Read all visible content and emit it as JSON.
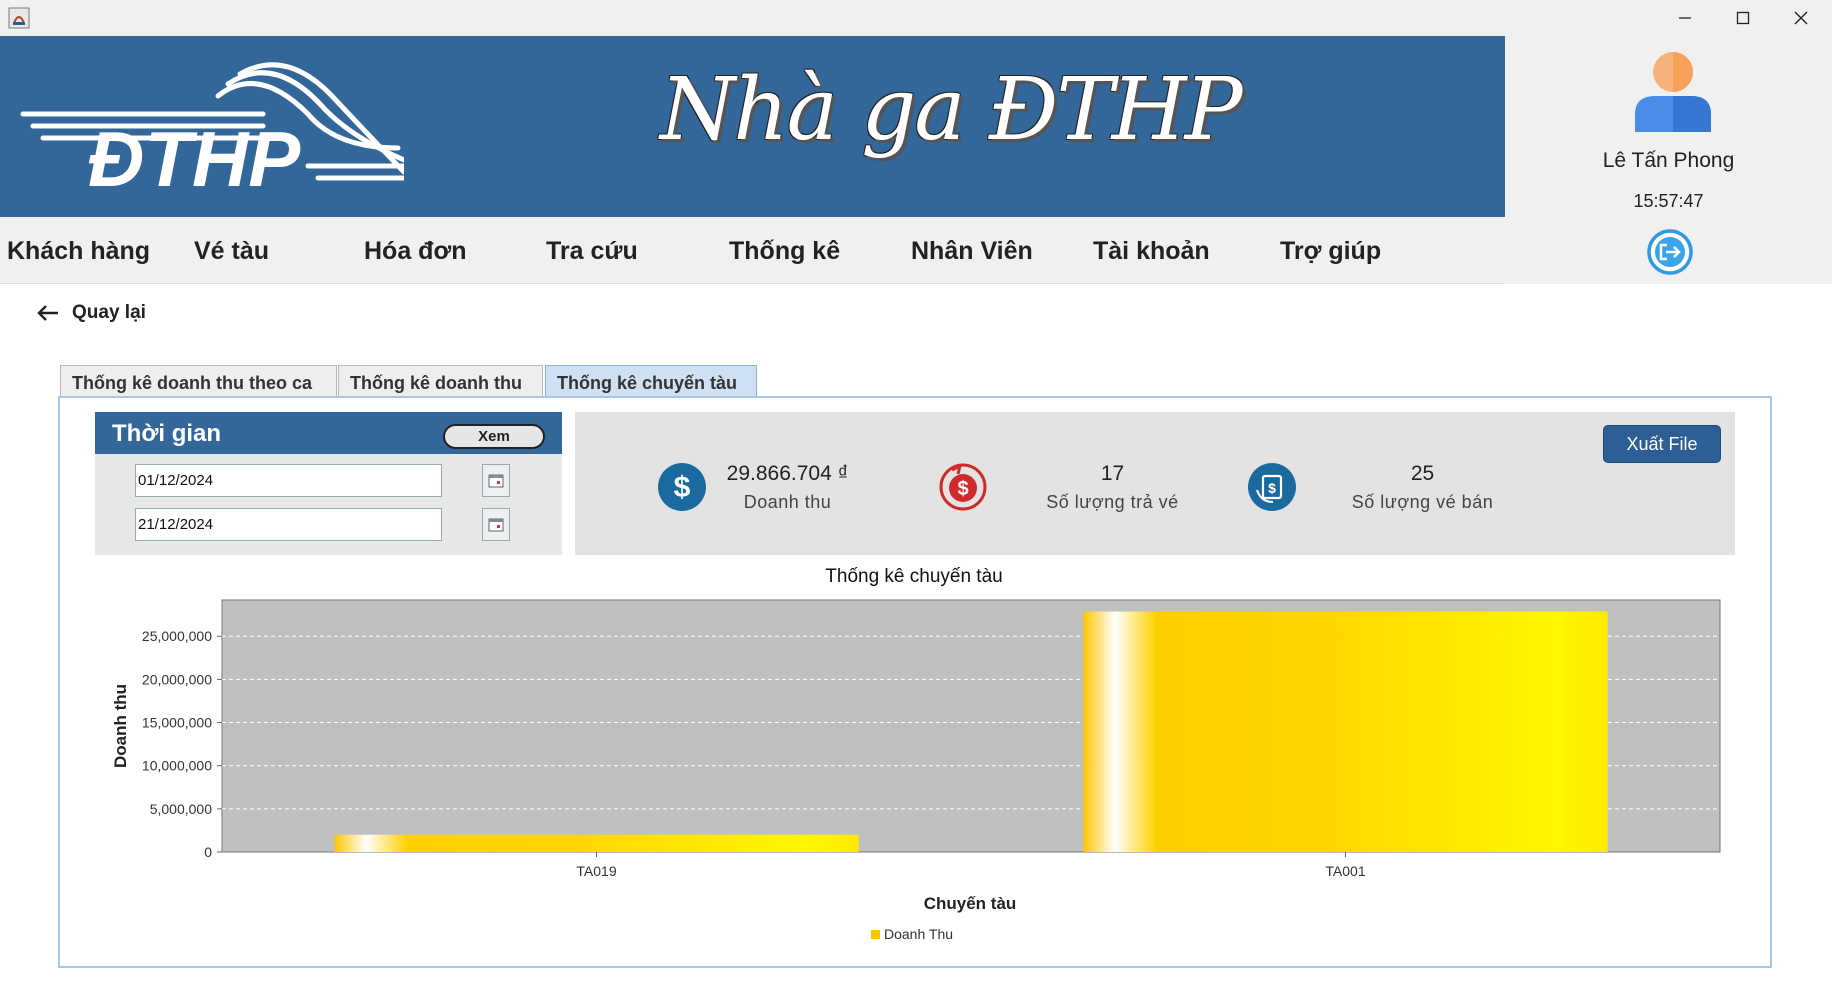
{
  "window": {
    "controls": [
      "minimize",
      "maximize",
      "close"
    ]
  },
  "header": {
    "logo_text": "ĐTHP",
    "title": "Nhà ga ĐTHP"
  },
  "user": {
    "name": "Lê Tấn Phong",
    "clock": "15:57:47"
  },
  "menu": [
    {
      "label": "Khách hàng"
    },
    {
      "label": "Vé tàu"
    },
    {
      "label": "Hóa đơn"
    },
    {
      "label": "Tra cứu"
    },
    {
      "label": "Thống kê"
    },
    {
      "label": "Nhân Viên"
    },
    {
      "label": "Tài khoản"
    },
    {
      "label": "Trợ giúp"
    }
  ],
  "back": {
    "label": "Quay lại"
  },
  "tabs": [
    {
      "label": "Thống kê doanh thu theo ca",
      "active": false
    },
    {
      "label": "Thống kê doanh thu",
      "active": false
    },
    {
      "label": "Thống kê chuyến tàu",
      "active": true
    }
  ],
  "time_panel": {
    "title": "Thời gian",
    "view_button": "Xem",
    "from_date": "01/12/2024",
    "to_date": "21/12/2024"
  },
  "stats": [
    {
      "value": "29.866.704 ₫",
      "label": "Doanh thu",
      "icon": "dollar-circle-icon",
      "color": "#1a6aa0"
    },
    {
      "value": "17",
      "label": "Số lượng trả vé",
      "icon": "refund-dollar-icon",
      "color": "#d12a2a"
    },
    {
      "value": "25",
      "label": "Số lượng vé bán",
      "icon": "ticket-sale-icon",
      "color": "#1a6aa0"
    }
  ],
  "export_button": "Xuất File",
  "chart_data": {
    "type": "bar",
    "title": "Thống kê chuyến tàu",
    "xlabel": "Chuyến tàu",
    "ylabel": "Doanh thu",
    "categories": [
      "TA019",
      "TA001"
    ],
    "series": [
      {
        "name": "Doanh Thu",
        "values": [
          2000000,
          27866704
        ],
        "color": "#ffd200"
      }
    ],
    "ylim": [
      0,
      29200000
    ],
    "yticks": [
      0,
      5000000,
      10000000,
      15000000,
      20000000,
      25000000
    ],
    "ytick_labels": [
      "0",
      "5,000,000",
      "10,000,000",
      "15,000,000",
      "20,000,000",
      "25,000,000"
    ],
    "plot_background": "#c0c0c0",
    "grid": true,
    "legend": "bottom-center"
  }
}
